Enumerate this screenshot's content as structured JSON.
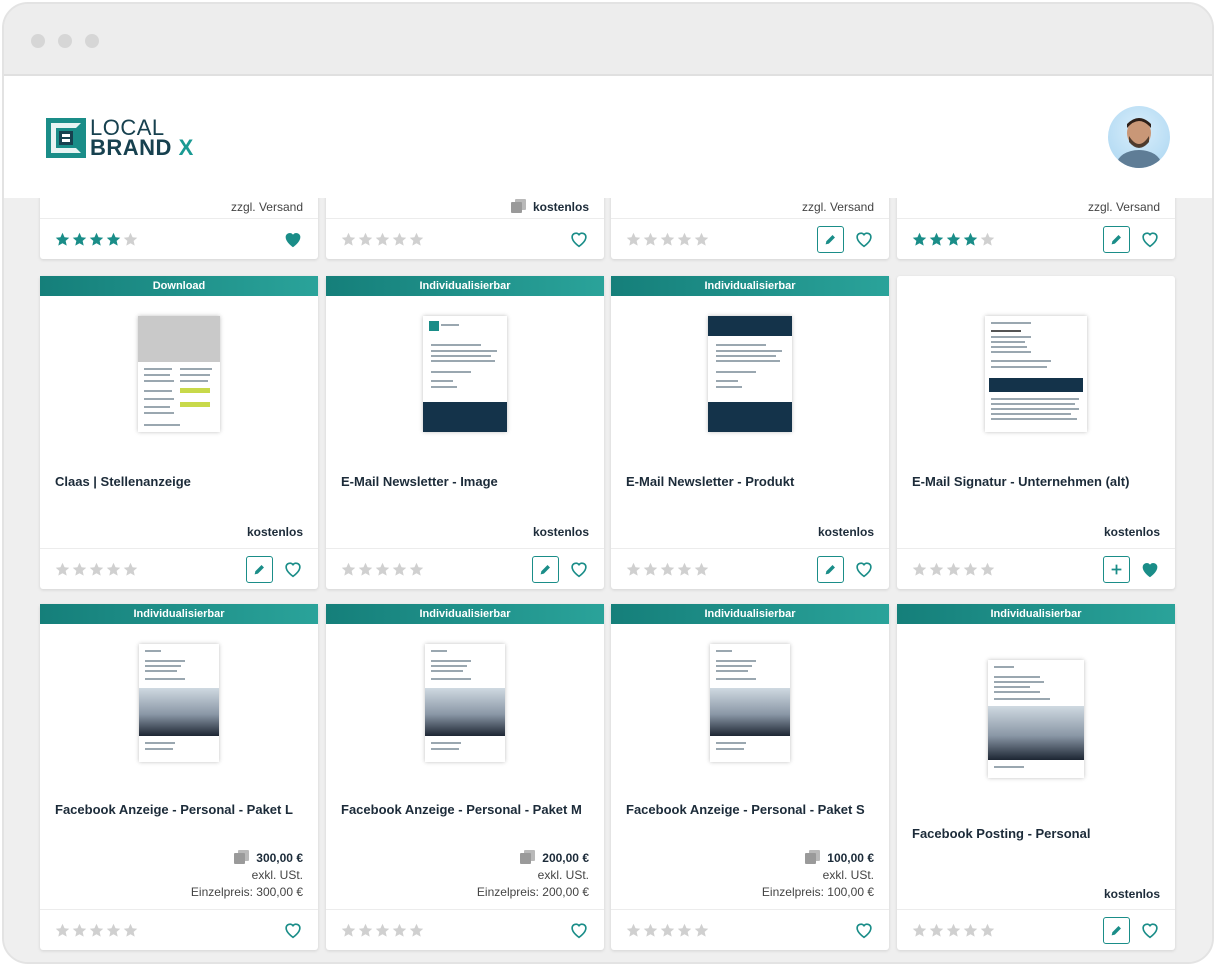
{
  "brand": {
    "line1": "LOCAL",
    "line2": "BRAND",
    "line2_accent": "X",
    "colors": {
      "primary": "#17414f",
      "accent": "#1a9a93"
    }
  },
  "header": {
    "avatar_icon": "user-avatar"
  },
  "colors": {
    "teal": "#1a8d88",
    "star_filled": "#1a8d88",
    "star_empty": "#d0d0d0"
  },
  "top_row": [
    {
      "price_text": "zzgl. Versand",
      "rating": 4,
      "favorited": true,
      "has_edit": false,
      "copy_icon": false
    },
    {
      "price_text": "kostenlos",
      "rating": 0,
      "favorited": false,
      "has_edit": false,
      "copy_icon": true
    },
    {
      "price_text": "zzgl. Versand",
      "rating": 0,
      "favorited": false,
      "has_edit": true,
      "copy_icon": false
    },
    {
      "price_text": "zzgl. Versand",
      "rating": 4,
      "favorited": false,
      "has_edit": true,
      "copy_icon": false
    }
  ],
  "row2": [
    {
      "badge": "Download",
      "title": "Claas | Stellenanzeige",
      "price": "kostenlos",
      "rating": 0,
      "favorited": false,
      "action": "edit"
    },
    {
      "badge": "Individualisierbar",
      "title": "E-Mail Newsletter - Image",
      "price": "kostenlos",
      "rating": 0,
      "favorited": false,
      "action": "edit"
    },
    {
      "badge": "Individualisierbar",
      "title": "E-Mail Newsletter - Produkt",
      "price": "kostenlos",
      "rating": 0,
      "favorited": false,
      "action": "edit"
    },
    {
      "badge": "",
      "title": "E-Mail Signatur - Unternehmen (alt)",
      "price": "kostenlos",
      "rating": 0,
      "favorited": true,
      "action": "add"
    }
  ],
  "row3": [
    {
      "badge": "Individualisierbar",
      "title": "Facebook Anzeige - Personal - Paket L",
      "price": "300,00 €",
      "tax": "exkl. USt.",
      "unit": "Einzelpreis: 300,00 €",
      "rating": 0,
      "favorited": false
    },
    {
      "badge": "Individualisierbar",
      "title": "Facebook Anzeige - Personal - Paket M",
      "price": "200,00 €",
      "tax": "exkl. USt.",
      "unit": "Einzelpreis: 200,00 €",
      "rating": 0,
      "favorited": false
    },
    {
      "badge": "Individualisierbar",
      "title": "Facebook Anzeige - Personal - Paket S",
      "price": "100,00 €",
      "tax": "exkl. USt.",
      "unit": "Einzelpreis: 100,00 €",
      "rating": 0,
      "favorited": false
    },
    {
      "badge": "Individualisierbar",
      "title": "Facebook Posting - Personal",
      "price": "kostenlos",
      "rating": 0,
      "favorited": false,
      "action": "edit"
    }
  ]
}
